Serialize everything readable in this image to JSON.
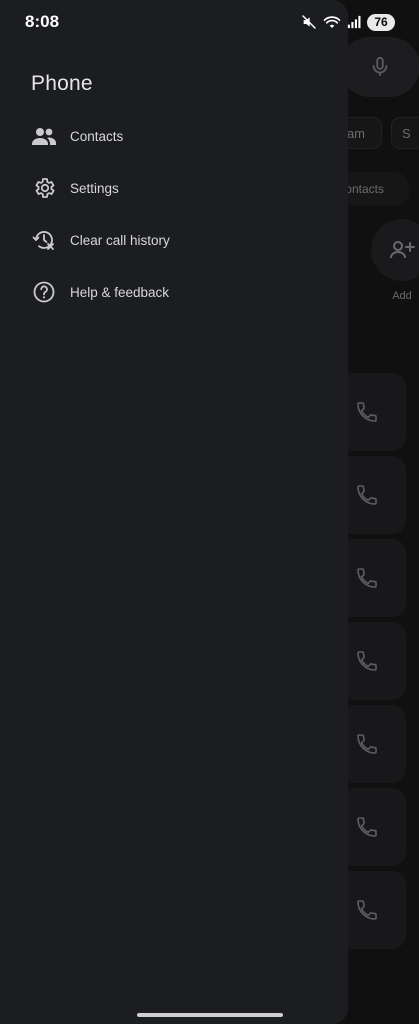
{
  "status_bar": {
    "time": "8:08",
    "battery": "76",
    "icons": [
      "mute-icon",
      "wifi-icon",
      "signal-icon"
    ]
  },
  "drawer": {
    "title": "Phone",
    "items": [
      {
        "label": "Contacts",
        "icon": "contacts-icon"
      },
      {
        "label": "Settings",
        "icon": "gear-icon"
      },
      {
        "label": "Clear call history",
        "icon": "clear-history-icon"
      },
      {
        "label": "Help & feedback",
        "icon": "help-icon"
      }
    ]
  },
  "background": {
    "chip_1_text": "am",
    "chip_2_text": "S",
    "chip_3_text": "ontacts",
    "add_label": "Add"
  }
}
